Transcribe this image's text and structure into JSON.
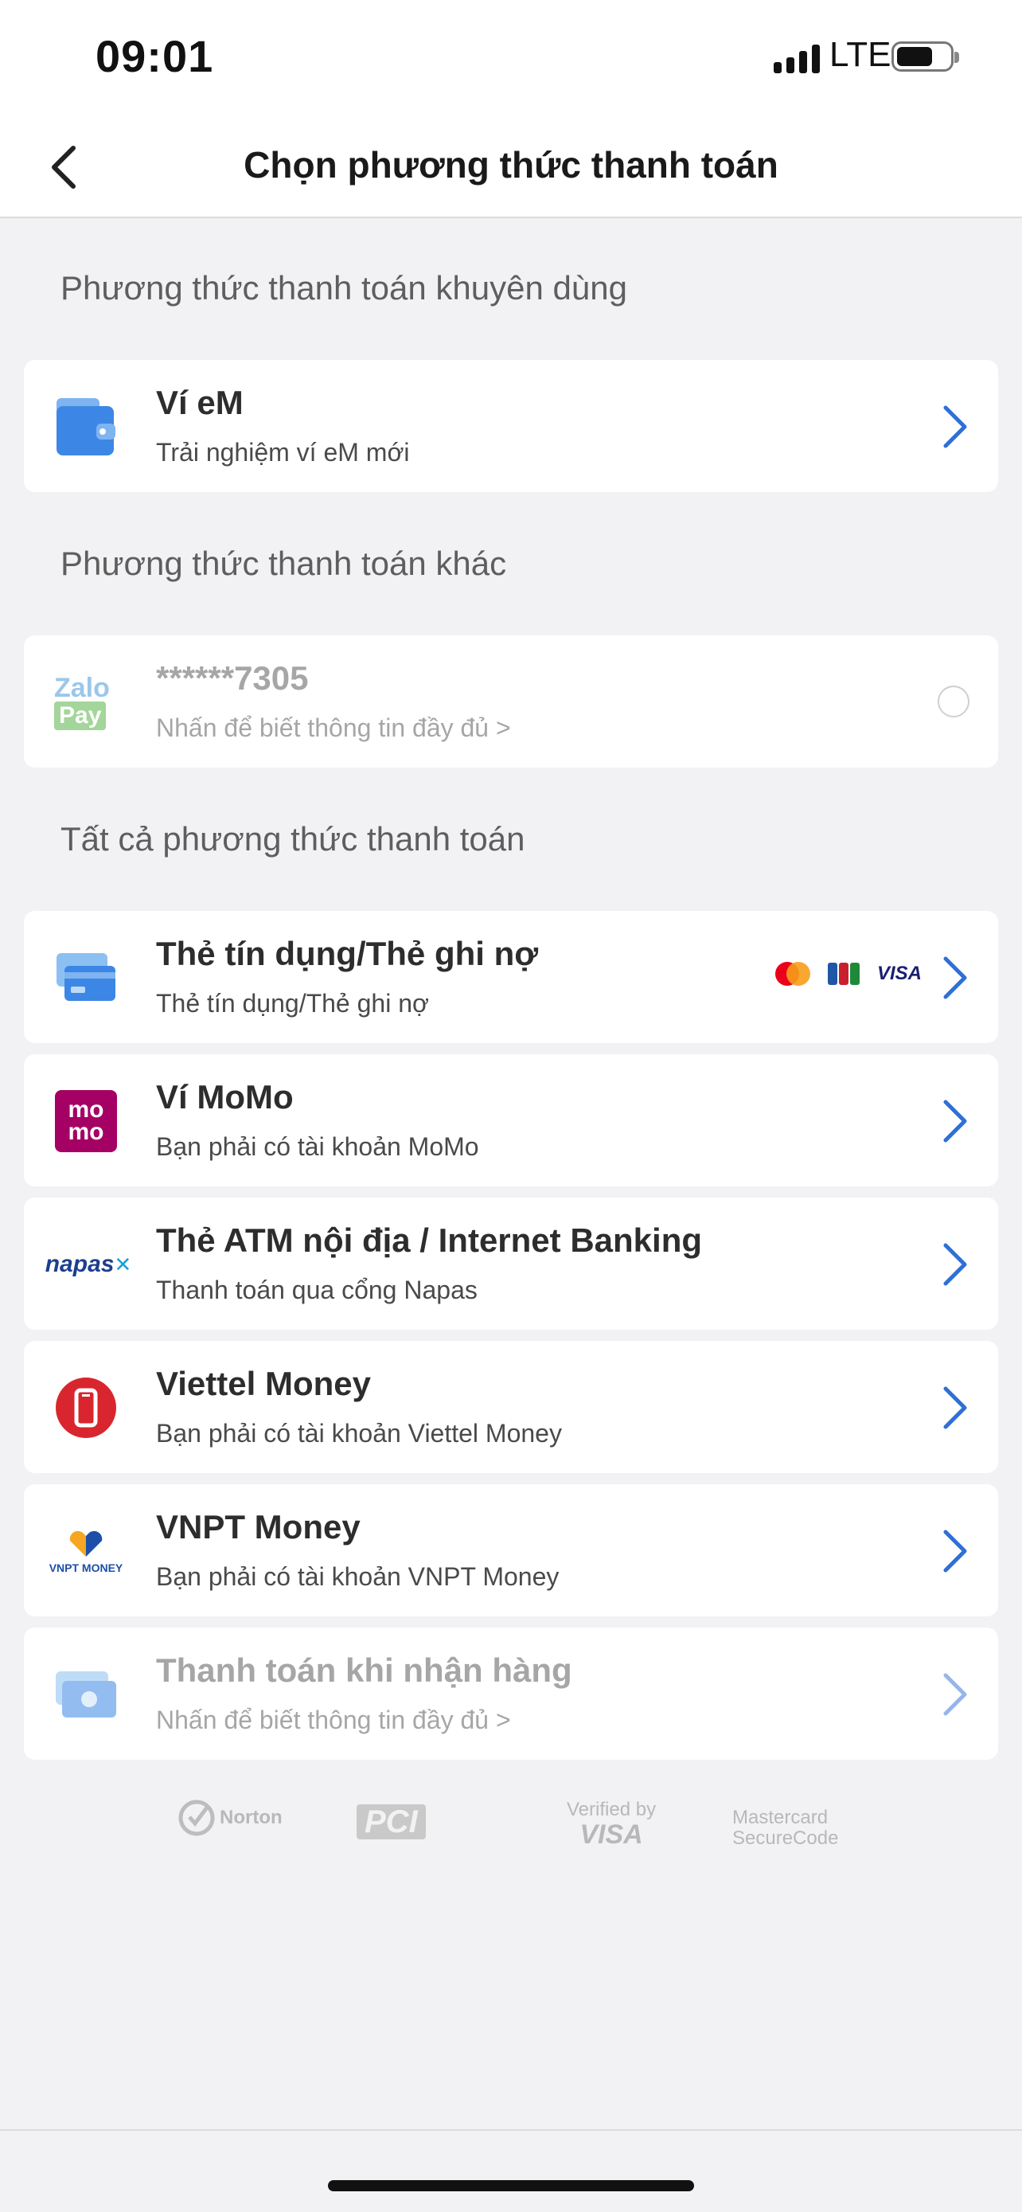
{
  "status_bar": {
    "time": "09:01",
    "network": "LTE"
  },
  "header": {
    "title": "Chọn phương thức thanh toán"
  },
  "sections": {
    "recommended": "Phương thức thanh toán khuyên dùng",
    "other": "Phương thức thanh toán khác",
    "all": "Tất cả phương thức thanh toán"
  },
  "methods": [
    {
      "title": "Ví eM",
      "subtitle": "Trải nghiệm ví eM mới"
    },
    {
      "title": "******7305",
      "subtitle": "Nhấn để biết thông tin đầy đủ >",
      "logo_top": "Zalo",
      "logo_bottom": "Pay"
    },
    {
      "title": "Thẻ tín dụng/Thẻ ghi nợ",
      "subtitle": "Thẻ tín dụng/Thẻ ghi nợ",
      "brand_visa": "VISA"
    },
    {
      "title": "Ví MoMo",
      "subtitle": "Bạn phải có tài khoản MoMo",
      "logo_top": "mo",
      "logo_bottom": "mo"
    },
    {
      "title": "Thẻ ATM nội địa / Internet Banking",
      "subtitle": "Thanh toán qua cổng Napas",
      "logo": "napas"
    },
    {
      "title": "Viettel Money",
      "subtitle": "Bạn phải có tài khoản Viettel Money"
    },
    {
      "title": "VNPT Money",
      "subtitle": "Bạn phải có tài khoản VNPT Money",
      "logo": "VNPT MONEY"
    },
    {
      "title": "Thanh toán khi nhận hàng",
      "subtitle": "Nhấn để biết thông tin đầy đủ >"
    }
  ],
  "footer": {
    "norton": "Norton",
    "pci": "PCI",
    "visa_verified_top": "Verified by",
    "visa_verified_bottom": "VISA",
    "mastercard_top": "Mastercard",
    "mastercard_bottom": "SecureCode"
  },
  "colors": {
    "accent_blue": "#2f6fd6",
    "page_bg": "#f2f2f4"
  }
}
